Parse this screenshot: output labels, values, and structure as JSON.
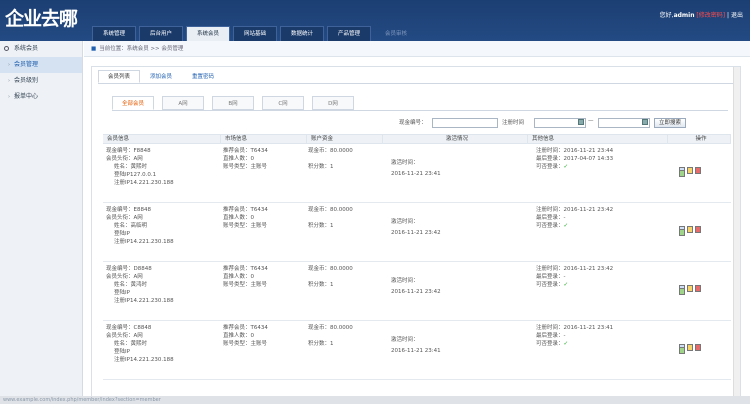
{
  "app": {
    "logo": "企业去哪",
    "nav": [
      "系统管理",
      "后台用户",
      "系统会员",
      "网站基础",
      "数据统计",
      "产品管理",
      "会员审核"
    ],
    "nav_active": 2,
    "user_prefix": "您好,",
    "user_name": "admin",
    "user_action": "[修改密码]",
    "user_sep": "|",
    "user_exit": "退出"
  },
  "sidebar": {
    "header": "系统会员",
    "items": [
      "会员管理",
      "会员级别",
      "报单中心"
    ]
  },
  "breadcrumb": "当前位置：系统会员 >> 会员管理",
  "tabs": [
    "会员列表",
    "添加会员",
    "重置密码"
  ],
  "subtabs": [
    "全部会员",
    "A网",
    "B网",
    "C网",
    "D网"
  ],
  "filter": {
    "code_label": "现金编号：",
    "time_label": "注册时间",
    "dash": "—",
    "search_button": "立即搜索"
  },
  "table": {
    "headers": [
      "会员信息",
      "市场信息",
      "账户资金",
      "激活情况",
      "其他信息",
      "操作"
    ],
    "rows": [
      {
        "code": "现金编号：F8848",
        "head": "会员头衔：A网",
        "name": "姓名：黄熙时",
        "ip_label": "登陆IP127.0.0.1",
        "reg_ip": "注册IP14.221.230.188",
        "rec": "推荐会员：T6434",
        "direct": "直推人数：0",
        "acct": "账号类型：主账号",
        "cash": "现金币：80.0000",
        "bonus": "积分数：1",
        "act_label": "激活时间：",
        "act_time": "2016-11-21 23:41",
        "reg_time": "注册时间：2016-11-21 23:44",
        "last_login": "最后登录：2017-04-07 14:33",
        "can_login": "可否登录："
      },
      {
        "code": "现金编号：E8848",
        "head": "会员头衔：A网",
        "name": "姓名：高临明",
        "ip_label": "登陆IP",
        "reg_ip": "注册IP14.221.230.188",
        "rec": "推荐会员：T6434",
        "direct": "直推人数：0",
        "acct": "账号类型：主账号",
        "cash": "现金币：80.0000",
        "bonus": "积分数：1",
        "act_label": "激活时间：",
        "act_time": "2016-11-21 23:42",
        "reg_time": "注册时间：2016-11-21 23:42",
        "last_login": "最后登录：-",
        "can_login": "可否登录："
      },
      {
        "code": "现金编号：D8848",
        "head": "会员头衔：A网",
        "name": "姓名：黄鸿时",
        "ip_label": "登陆IP",
        "reg_ip": "注册IP14.221.230.188",
        "rec": "推荐会员：T6434",
        "direct": "直推人数：0",
        "acct": "账号类型：主账号",
        "cash": "现金币：80.0000",
        "bonus": "积分数：1",
        "act_label": "激活时间：",
        "act_time": "2016-11-21 23:42",
        "reg_time": "注册时间：2016-11-21 23:42",
        "last_login": "最后登录：-",
        "can_login": "可否登录："
      },
      {
        "code": "现金编号：C8848",
        "head": "会员头衔：A网",
        "name": "姓名：黄熙时",
        "ip_label": "登陆IP",
        "reg_ip": "注册IP14.221.230.188",
        "rec": "推荐会员：T6434",
        "direct": "直推人数：0",
        "acct": "账号类型：主账号",
        "cash": "现金币：80.0000",
        "bonus": "积分数：1",
        "act_label": "激活时间：",
        "act_time": "2016-11-21 23:41",
        "reg_time": "注册时间：2016-11-21 23:41",
        "last_login": "最后登录：-",
        "can_login": "可否登录："
      }
    ]
  },
  "status_url": "www.example.com/index.php/member/index?section=member"
}
